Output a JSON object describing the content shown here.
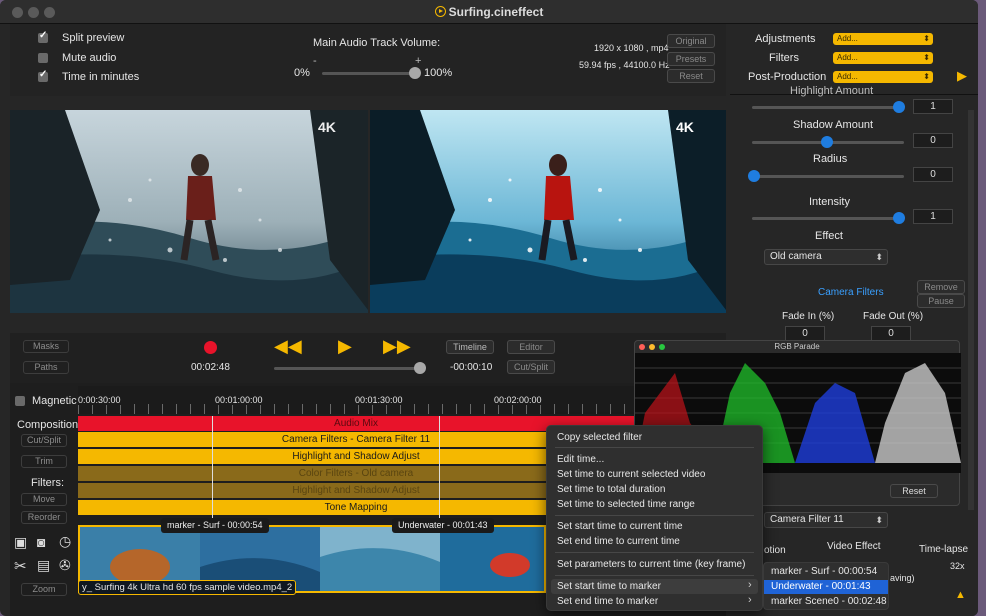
{
  "window": {
    "title": "Surfing.cineffect"
  },
  "options": {
    "split_preview": "Split preview",
    "mute_audio": "Mute audio",
    "time_in_minutes": "Time in minutes"
  },
  "audio": {
    "label": "Main Audio Track Volume:",
    "minus": "-",
    "plus": "+",
    "min": "0%",
    "max": "100%",
    "level": 1.0
  },
  "media_info": {
    "resolution": "1920 x 1080 , mp4",
    "fps": "59.94 fps , 44100.0 Hz"
  },
  "top_buttons": {
    "original": "Original",
    "presets": "Presets",
    "reset": "Reset"
  },
  "right_panel": {
    "adjustments_label": "Adjustments",
    "filters_label": "Filters",
    "postproduction_label": "Post-Production",
    "add_label": "Add...",
    "highlight_label": "Highlight Amount",
    "highlight_value": "1",
    "shadow_label": "Shadow Amount",
    "shadow_value": "0",
    "radius_label": "Radius",
    "radius_value": "0",
    "intensity_label": "Intensity",
    "intensity_value": "1",
    "effect_label": "Effect",
    "effect_value": "Old camera",
    "camera_filters": "Camera Filters",
    "remove": "Remove",
    "pause": "Pause",
    "fade_in_label": "Fade In (%)",
    "fade_in_value": "0",
    "fade_out_label": "Fade Out (%)",
    "fade_out_value": "0",
    "filter_select": "Camera Filter 11",
    "motion_label": "otion",
    "video_effect_label": "Video Effect",
    "timelapse_label": "Time-lapse",
    "timelapse_value": "32x",
    "saving_label": "aving)"
  },
  "preview": {
    "badge": "4K"
  },
  "controls": {
    "masks": "Masks",
    "paths": "Paths",
    "current_time": "00:02:48",
    "remaining_time": "-00:00:10",
    "timeline": "Timeline",
    "editor": "Editor",
    "cut_split": "Cut/Split"
  },
  "timeline": {
    "magnetic": "Magnetic",
    "ticks": [
      "0:00:30:00",
      "00:01:00:00",
      "00:01:30:00",
      "00:02:00:00"
    ],
    "composition_label": "Composition:",
    "filters_label": "Filters:",
    "cut_split": "Cut/Split",
    "trim": "Trim",
    "move": "Move",
    "reorder": "Reorder",
    "zoom": "Zoom",
    "tracks": [
      {
        "label": "Audio Mix",
        "color": "#e8132a"
      },
      {
        "label": "Camera Filters - Camera Filter 11",
        "color": "#f5b800"
      },
      {
        "label": "Highlight and Shadow Adjust",
        "color": "#f5b800"
      },
      {
        "label": "Color Filters - Old camera",
        "color": "#8a6a1a"
      },
      {
        "label": "Highlight and Shadow Adjust",
        "color": "#8a6a1a"
      },
      {
        "label": "Tone Mapping",
        "color": "#f5b800"
      }
    ],
    "marker_surf": "marker - Surf - 00:00:54",
    "marker_underwater": "Underwater - 00:01:43",
    "clip_name": "y_ Surfing 4k Ultra hd 60 fps sample video.mp4_2"
  },
  "parade": {
    "title": "RGB Parade",
    "reset": "Reset"
  },
  "context_menu": {
    "items": [
      "Copy selected filter",
      "Edit time...",
      "Set time to current selected video",
      "Set time to total duration",
      "Set time to selected time range",
      "Set start time to current time",
      "Set end time to current time",
      "Set parameters to current time (key frame)",
      "Set start time to marker",
      "Set end time to marker"
    ]
  },
  "submenu": {
    "items": [
      "marker - Surf - 00:00:54",
      "Underwater - 00:01:43",
      "marker Scene0 - 00:02:48"
    ]
  },
  "colors": {
    "accent": "#f5b800",
    "record": "#e8132a",
    "selection": "#1f63d6",
    "blue_link": "#3aa0ff"
  }
}
